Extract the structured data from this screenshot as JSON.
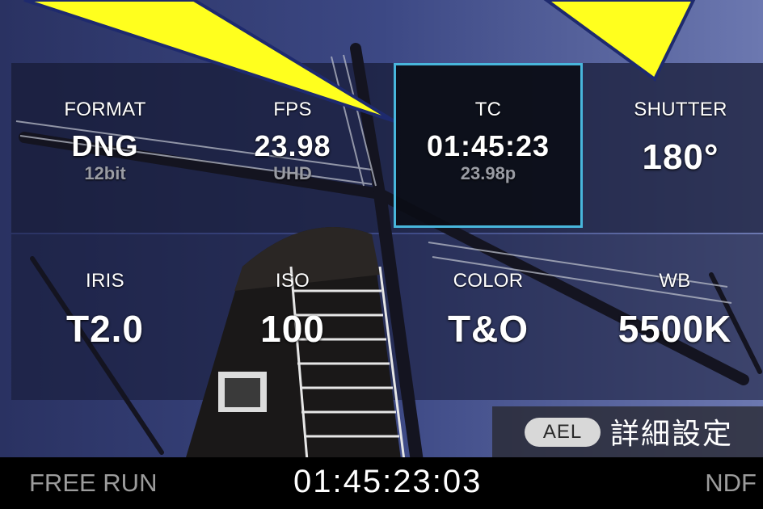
{
  "tiles": [
    {
      "label": "FORMAT",
      "value": "DNG",
      "sub": "12bit"
    },
    {
      "label": "FPS",
      "value": "23.98",
      "sub": "UHD"
    },
    {
      "label": "TC",
      "value": "01:45:23",
      "sub": "23.98p"
    },
    {
      "label": "SHUTTER",
      "value": "180°"
    },
    {
      "label": "IRIS",
      "value": "T2.0"
    },
    {
      "label": "ISO",
      "value": "100"
    },
    {
      "label": "COLOR",
      "value": "T&O"
    },
    {
      "label": "WB",
      "value": "5500K"
    }
  ],
  "selected_tile": "TC",
  "ael": {
    "badge": "AEL",
    "text": "詳細設定"
  },
  "status": {
    "left": "FREE RUN",
    "timecode": "01:45:23:03",
    "right": "NDF"
  },
  "colors": {
    "accent": "#48b6dc",
    "callout_fill": "#ffff1e",
    "callout_stroke": "#1e2a6e",
    "label_gray": "#9c9c9c"
  }
}
